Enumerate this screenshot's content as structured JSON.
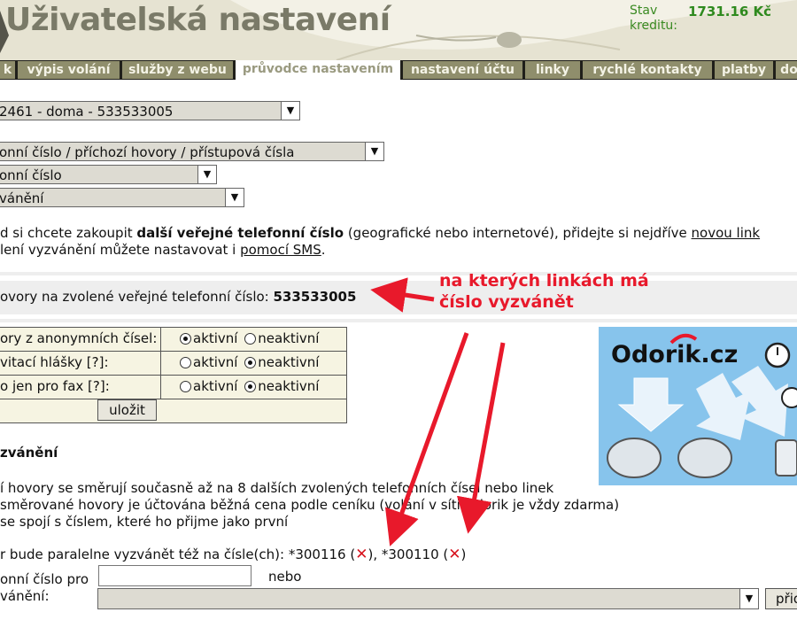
{
  "header": {
    "title": "Uživatelská nastavení",
    "credit_label": "Stav kreditu:",
    "credit_value": "1731.16 Kč"
  },
  "nav": {
    "tabs": [
      {
        "label": "k",
        "active": false
      },
      {
        "label": "výpis volání",
        "active": false
      },
      {
        "label": "služby z webu",
        "active": false
      },
      {
        "label": "průvodce nastavením",
        "active": true
      },
      {
        "label": "nastavení účtu",
        "active": false
      },
      {
        "label": "linky",
        "active": false
      },
      {
        "label": "rychlé kontakty",
        "active": false
      },
      {
        "label": "platby",
        "active": false
      },
      {
        "label": "do",
        "active": false
      }
    ]
  },
  "selects": {
    "line": "2461 - doma - 533533005",
    "category": "onní číslo / příchozí hovory / přístupová čísla",
    "subcategory": "onní číslo",
    "option": "vánění"
  },
  "info": {
    "line1_prefix": "d si chcete zakoupit ",
    "line1_bold": "další veřejné telefonní číslo",
    "line1_suffix": " (geografické nebo internetové), přidejte si nejdříve ",
    "line1_link": "novou link",
    "line2_prefix": "lení vyzvánění můžete nastavovat i ",
    "line2_link": "pomocí SMS",
    "line2_suffix": "."
  },
  "number_band": {
    "label": "ovory na zvolené veřejné telefonní číslo: ",
    "number": "533533005"
  },
  "annotation": {
    "line1": "na kterých linkách má",
    "line2": "číslo vyzvánět"
  },
  "settings": {
    "rows": [
      {
        "label": "ory z anonymních čísel:",
        "active_label": "aktivní",
        "inactive_label": "neaktivní",
        "selected": "active"
      },
      {
        "label": "vitací hlášky [?]:",
        "active_label": "aktivní",
        "inactive_label": "neaktivní",
        "selected": "inactive"
      },
      {
        "label": "o jen pro fax [?]:",
        "active_label": "aktivní",
        "inactive_label": "neaktivní",
        "selected": "inactive"
      }
    ],
    "save_label": "uložit"
  },
  "ringing": {
    "heading": "zvánění",
    "desc1": "í hovory se směrují současně až na 8 dalších zvolených telefonních čísel nebo linek",
    "desc2": " směrované hovory je účtována běžná cena podle ceníku (volání v síti Odorik je vždy zdarma)",
    "desc3": "se spojí s číslem, které ho přijme jako první",
    "parallel_prefix": "r bude paralelne vyzvánět též na čísle(ch): ",
    "numbers": [
      "*300116",
      "*300110"
    ],
    "add_label1": "onní číslo pro",
    "add_label2": "vánění:",
    "or_label": "nebo",
    "add_button": "přid"
  },
  "ad": {
    "brand": "Odorik.cz"
  },
  "colors": {
    "tab_bg": "#8f8e6c",
    "annotation": "#e8192b",
    "credit": "#2f8a1e",
    "ad_bg": "#87c4ec"
  }
}
